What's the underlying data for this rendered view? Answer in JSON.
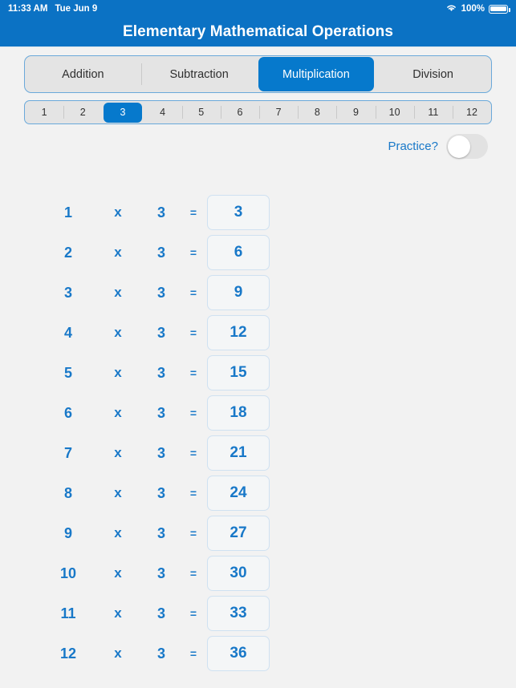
{
  "statusbar": {
    "time": "11:33 AM",
    "date": "Tue Jun 9",
    "battery_percent": "100%",
    "wifi_icon": "wifi-icon",
    "battery_icon": "battery-icon"
  },
  "header": {
    "title": "Elementary Mathematical Operations",
    "bar_color": "#0b72c4"
  },
  "operations": {
    "selected": "Multiplication",
    "items": [
      {
        "label": "Addition",
        "selected": false
      },
      {
        "label": "Subtraction",
        "selected": false
      },
      {
        "label": "Multiplication",
        "selected": true
      },
      {
        "label": "Division",
        "selected": false
      }
    ]
  },
  "numbers": {
    "selected": "3",
    "items": [
      {
        "label": "1",
        "selected": false
      },
      {
        "label": "2",
        "selected": false
      },
      {
        "label": "3",
        "selected": true
      },
      {
        "label": "4",
        "selected": false
      },
      {
        "label": "5",
        "selected": false
      },
      {
        "label": "6",
        "selected": false
      },
      {
        "label": "7",
        "selected": false
      },
      {
        "label": "8",
        "selected": false
      },
      {
        "label": "9",
        "selected": false
      },
      {
        "label": "10",
        "selected": false
      },
      {
        "label": "11",
        "selected": false
      },
      {
        "label": "12",
        "selected": false
      }
    ]
  },
  "practice": {
    "label": "Practice?",
    "enabled": false
  },
  "accent_color": "#0679cc",
  "text_color": "#1878c8",
  "equations": {
    "operator": "x",
    "equals": "=",
    "multiplier": "3",
    "rows": [
      {
        "operand": "1",
        "operator": "x",
        "multiplier": "3",
        "equals": "=",
        "result": "3"
      },
      {
        "operand": "2",
        "operator": "x",
        "multiplier": "3",
        "equals": "=",
        "result": "6"
      },
      {
        "operand": "3",
        "operator": "x",
        "multiplier": "3",
        "equals": "=",
        "result": "9"
      },
      {
        "operand": "4",
        "operator": "x",
        "multiplier": "3",
        "equals": "=",
        "result": "12"
      },
      {
        "operand": "5",
        "operator": "x",
        "multiplier": "3",
        "equals": "=",
        "result": "15"
      },
      {
        "operand": "6",
        "operator": "x",
        "multiplier": "3",
        "equals": "=",
        "result": "18"
      },
      {
        "operand": "7",
        "operator": "x",
        "multiplier": "3",
        "equals": "=",
        "result": "21"
      },
      {
        "operand": "8",
        "operator": "x",
        "multiplier": "3",
        "equals": "=",
        "result": "24"
      },
      {
        "operand": "9",
        "operator": "x",
        "multiplier": "3",
        "equals": "=",
        "result": "27"
      },
      {
        "operand": "10",
        "operator": "x",
        "multiplier": "3",
        "equals": "=",
        "result": "30"
      },
      {
        "operand": "11",
        "operator": "x",
        "multiplier": "3",
        "equals": "=",
        "result": "33"
      },
      {
        "operand": "12",
        "operator": "x",
        "multiplier": "3",
        "equals": "=",
        "result": "36"
      }
    ]
  }
}
